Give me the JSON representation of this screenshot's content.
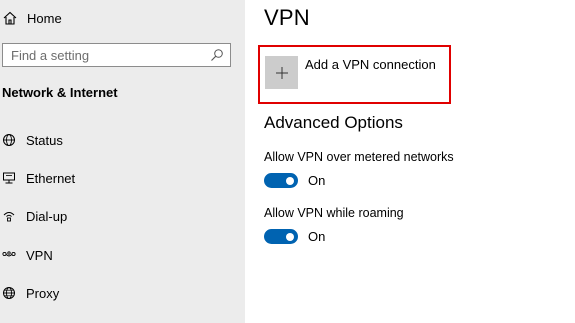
{
  "sidebar": {
    "home_label": "Home",
    "search_placeholder": "Find a setting",
    "section_title": "Network & Internet",
    "items": [
      {
        "label": "Status",
        "icon": "globe-status-icon"
      },
      {
        "label": "Ethernet",
        "icon": "ethernet-icon"
      },
      {
        "label": "Dial-up",
        "icon": "dialup-icon"
      },
      {
        "label": "VPN",
        "icon": "vpn-icon"
      },
      {
        "label": "Proxy",
        "icon": "proxy-globe-icon"
      }
    ]
  },
  "main": {
    "title": "VPN",
    "add_vpn_label": "Add a VPN connection",
    "advanced_title": "Advanced Options",
    "options": [
      {
        "label": "Allow VPN over metered networks",
        "state": "On",
        "enabled": true
      },
      {
        "label": "Allow VPN while roaming",
        "state": "On",
        "enabled": true
      }
    ]
  },
  "colors": {
    "accent": "#0063b1",
    "highlight_border": "#e00000",
    "sidebar_bg": "#ececec"
  }
}
